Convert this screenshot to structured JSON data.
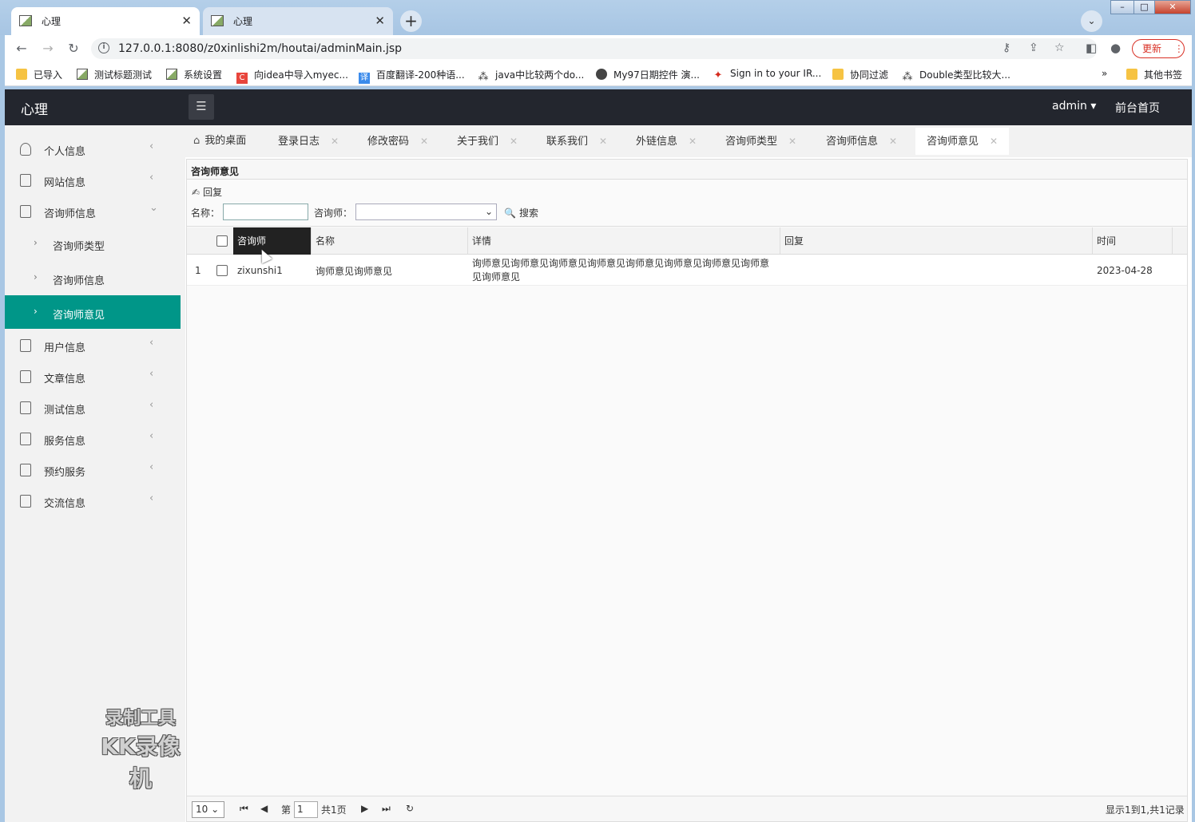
{
  "browser": {
    "tabs": [
      {
        "title": "心理",
        "close": "✕"
      },
      {
        "title": "心理",
        "close": "✕"
      }
    ],
    "new_tab": "+",
    "tab_search": "⌄",
    "window_controls": {
      "minimize": "–",
      "maximize": "□",
      "close": "✕"
    },
    "url": "127.0.0.1:8080/z0xinlishi2m/houtai/adminMain.jsp",
    "update_label": "更新",
    "bookmarks": [
      {
        "label": "已导入",
        "icon": "folder-icon"
      },
      {
        "label": "测试标题测试",
        "icon": "image-icon"
      },
      {
        "label": "系统设置",
        "icon": "image-icon"
      },
      {
        "label": "向idea中导入myec...",
        "icon": "c-icon"
      },
      {
        "label": "百度翻译-200种语...",
        "icon": "translate-icon"
      },
      {
        "label": "java中比较两个do...",
        "icon": "glyph-icon"
      },
      {
        "label": "My97日期控件 演...",
        "icon": "globe-icon"
      },
      {
        "label": "Sign in to your IR...",
        "icon": "maple-leaf-icon"
      },
      {
        "label": "协同过滤",
        "icon": "folder-icon"
      },
      {
        "label": "Double类型比较大...",
        "icon": "glyph-icon"
      }
    ],
    "more_bookmarks": "»",
    "other_bookmarks": "其他书签"
  },
  "app": {
    "logo": "心理",
    "user": "admin ▾",
    "front_home": "前台首页"
  },
  "sidebar": {
    "items": [
      {
        "label": "个人信息"
      },
      {
        "label": "网站信息"
      },
      {
        "label": "咨询师信息"
      },
      {
        "label": "用户信息"
      },
      {
        "label": "文章信息"
      },
      {
        "label": "测试信息"
      },
      {
        "label": "服务信息"
      },
      {
        "label": "预约服务"
      },
      {
        "label": "交流信息"
      }
    ],
    "subitems": [
      {
        "label": "咨询师类型"
      },
      {
        "label": "咨询师信息"
      },
      {
        "label": "咨询师意见"
      }
    ]
  },
  "page_tabs": [
    {
      "label": "我的桌面"
    },
    {
      "label": "登录日志"
    },
    {
      "label": "修改密码"
    },
    {
      "label": "关于我们"
    },
    {
      "label": "联系我们"
    },
    {
      "label": "外链信息"
    },
    {
      "label": "咨询师类型"
    },
    {
      "label": "咨询师信息"
    },
    {
      "label": "咨询师意见"
    }
  ],
  "panel": {
    "title": "咨询师意见",
    "reply_label": "回复",
    "name_label": "名称：",
    "counselor_label": "咨询师：",
    "search_label": "搜索"
  },
  "grid": {
    "columns": [
      "咨询师",
      "名称",
      "详情",
      "回复",
      "时间"
    ],
    "rows": [
      {
        "index": "1",
        "counselor": "zixunshi1",
        "name": "询师意见询师意见",
        "detail": "询师意见询师意见询师意见询师意见询师意见询师意见询师意见询师意见询师意见",
        "reply": "",
        "time": "2023-04-28"
      }
    ]
  },
  "pager": {
    "page_size": "10",
    "page_prefix": "第",
    "page_number": "1",
    "page_total": "共1页",
    "summary": "显示1到1,共1记录"
  },
  "watermark": {
    "line1": "录制工具",
    "line2": "KK录像机"
  }
}
